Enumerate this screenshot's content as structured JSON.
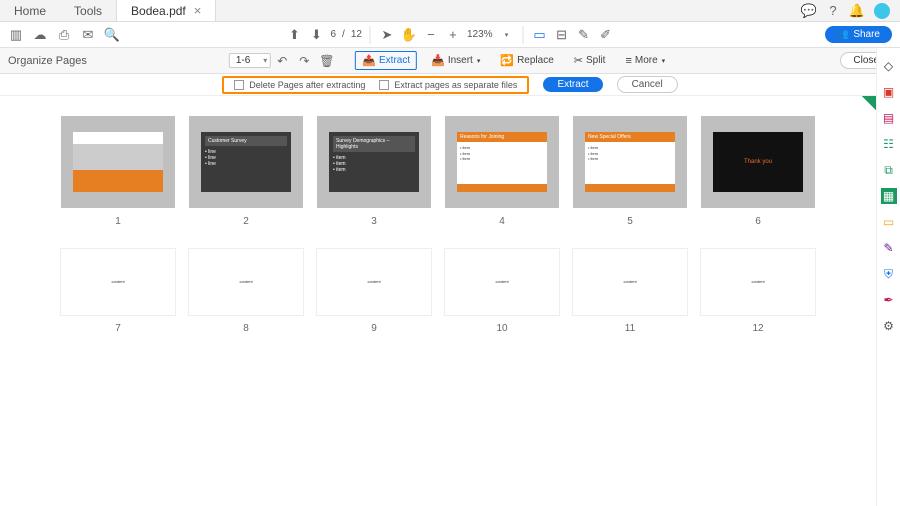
{
  "tabs": {
    "home": "Home",
    "tools": "Tools",
    "doc": "Bodea.pdf"
  },
  "toolbar": {
    "page_current": "6",
    "page_sep": "/",
    "page_total": "12",
    "zoom": "123%",
    "share": "Share"
  },
  "organize": {
    "title": "Organize Pages",
    "range": "1-6",
    "tools": {
      "extract": "Extract",
      "insert": "Insert",
      "replace": "Replace",
      "split": "Split",
      "more": "More"
    },
    "close": "Close"
  },
  "extract": {
    "opt_delete": "Delete Pages after extracting",
    "opt_separate": "Extract pages as separate files",
    "do": "Extract",
    "cancel": "Cancel"
  },
  "pages": {
    "row1": [
      {
        "num": "1"
      },
      {
        "num": "2",
        "title": "Customer Survey"
      },
      {
        "num": "3",
        "title": "Survey Demographics – Highlights"
      },
      {
        "num": "4",
        "title": "Reasons for Joining"
      },
      {
        "num": "5",
        "title": "New Special Offers"
      },
      {
        "num": "6",
        "title": "Thank you"
      }
    ],
    "row2": [
      {
        "num": "7"
      },
      {
        "num": "8"
      },
      {
        "num": "9"
      },
      {
        "num": "10"
      },
      {
        "num": "11"
      },
      {
        "num": "12"
      }
    ]
  },
  "rail_colors": {
    "pdf": "#d9362e",
    "edit": "#d9362e",
    "create": "#c2185b",
    "export": "#1a9960",
    "combine": "#1a9960",
    "organize": "#1a9960",
    "comment": "#f5a623",
    "fill": "#6a1b9a",
    "protect": "#1473e6",
    "sign": "#c2185b",
    "tools": "#555"
  }
}
